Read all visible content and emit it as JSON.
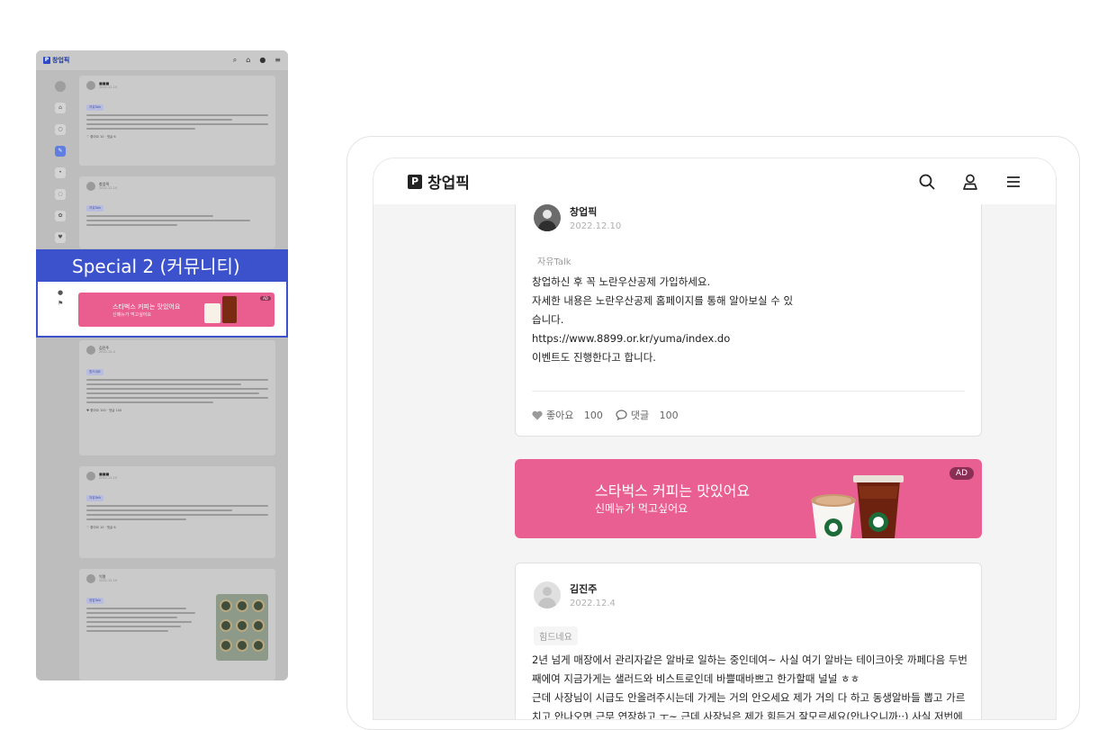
{
  "thumbnail": {
    "brand": "창업픽",
    "special_label": "Special 2 (커뮤니티)",
    "ad_title": "스타벅스 커피는 맛있어요",
    "ad_sub": "신메뉴가 먹고싶어요",
    "ad_badge": "AD"
  },
  "header": {
    "brand": "창업픽",
    "icons": [
      "search-icon",
      "user-icon",
      "menu-icon"
    ]
  },
  "post1": {
    "author": "창업픽",
    "date": "2022.12.10",
    "category": "자유Talk",
    "lines": [
      "창업하신 후 꼭 노란우산공제 가입하세요.",
      "자세한 내용은 노란우산공제 홈페이지를 통해 알아보실 수 있",
      "습니다.",
      "https://www.8899.or.kr/yuma/index.do",
      "이벤트도 진행한다고 합니다."
    ],
    "like_label": "좋아요",
    "like_count": "100",
    "comment_label": "댓글",
    "comment_count": "100"
  },
  "ad": {
    "title": "스타벅스 커피는 맛있어요",
    "subtitle": "신메뉴가 먹고싶어요",
    "badge": "AD"
  },
  "post2": {
    "author": "김진주",
    "date": "2022.12.4",
    "category": "힘드네요",
    "lines": [
      "2년 넘게 매장에서 관리자같은 알바로 일하는 중인데여~ 사실 여기 알바는 테이크아웃 까페다음 두번",
      "째에여 지금가게는 샐러드와 비스트로인데 바쁠때바쁘고 한가할때 널널 ㅎㅎ",
      "근데 사장님이 시급도 안올려주시는데 가게는 거의 안오세요 제가 거의 다 하고 동생알바들 뽑고 가르",
      "치고 안나오면 근무 연장하고 ㅜ~ 근데 사장님은 제가 힘든거 잘모르세요(안나오니까··) 사실 저번에"
    ]
  },
  "colors": {
    "accent": "#3b52cc",
    "ad_pink": "#ea5f91",
    "ad_badge": "#8b2e55"
  }
}
